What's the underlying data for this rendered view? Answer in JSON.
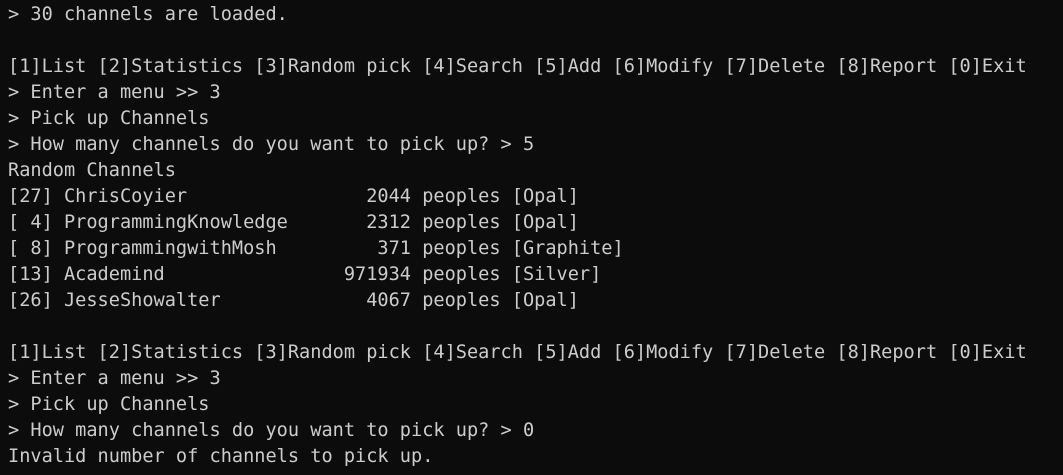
{
  "theme": {
    "background": "#0c0c0c",
    "foreground": "#cccccc"
  },
  "lines": [
    "> 30 channels are loaded.",
    "",
    "[1]List [2]Statistics [3]Random pick [4]Search [5]Add [6]Modify [7]Delete [8]Report [0]Exit",
    "> Enter a menu >> 3",
    "> Pick up Channels",
    "> How many channels do you want to pick up? > 5",
    "Random Channels",
    "[27] ChrisCoyier                2044 peoples [Opal]",
    "[ 4] ProgrammingKnowledge       2312 peoples [Opal]",
    "[ 8] ProgrammingwithMosh         371 peoples [Graphite]",
    "[13] Academind                971934 peoples [Silver]",
    "[26] JesseShowalter             4067 peoples [Opal]",
    "",
    "[1]List [2]Statistics [3]Random pick [4]Search [5]Add [6]Modify [7]Delete [8]Report [0]Exit",
    "> Enter a menu >> 3",
    "> Pick up Channels",
    "> How many channels do you want to pick up? > 0",
    "Invalid number of channels to pick up."
  ]
}
